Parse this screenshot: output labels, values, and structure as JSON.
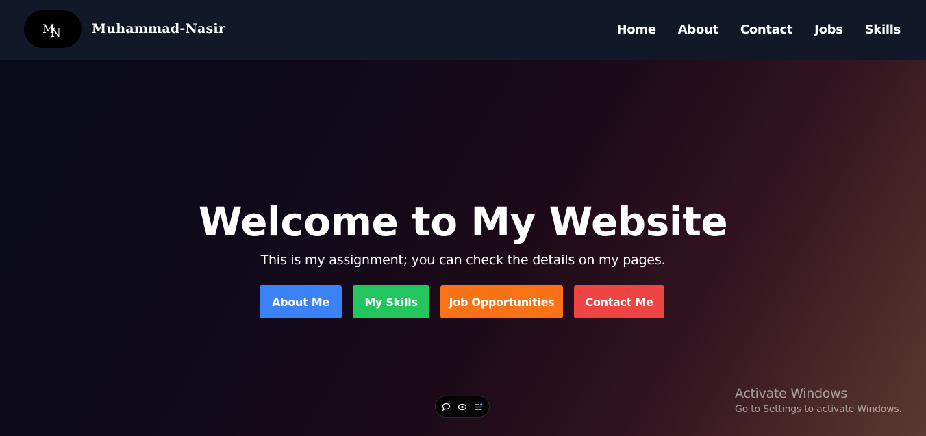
{
  "nav": {
    "logo_text": "MN",
    "brand": "Muhammad-Nasir",
    "links": [
      "Home",
      "About",
      "Contact",
      "Jobs",
      "Skills"
    ]
  },
  "hero": {
    "title": "Welcome to My Website",
    "subtitle": "This is my assignment; you can check the details on my pages.",
    "buttons": [
      {
        "label": "About Me",
        "color": "#3b82f6"
      },
      {
        "label": "My Skills",
        "color": "#22c55e"
      },
      {
        "label": "Job Opportunities",
        "color": "#f97316"
      },
      {
        "label": "Contact Me",
        "color": "#ef4444"
      }
    ]
  },
  "toolbar": {
    "icons": [
      "comment-icon",
      "eye-icon",
      "settings-list-icon"
    ]
  },
  "watermark": {
    "title": "Activate Windows",
    "subtitle": "Go to Settings to activate Windows."
  },
  "colors": {
    "navbar_bg": "#111827",
    "hero_gradient_start": "#0a0b1a",
    "hero_gradient_end": "#5a3a2e"
  }
}
